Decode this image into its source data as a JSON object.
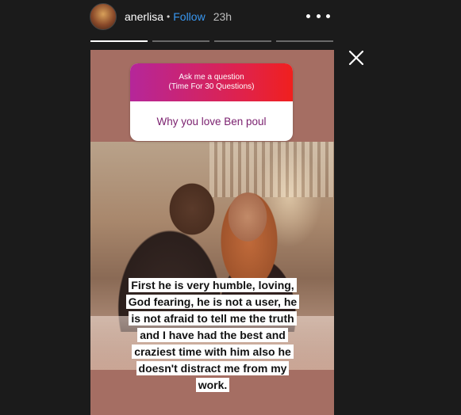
{
  "header": {
    "username": "anerlisa",
    "separator": "•",
    "follow_label": "Follow",
    "time": "23h"
  },
  "progress": [
    1.0,
    0.0,
    0.0,
    0.0
  ],
  "icons": {
    "avatar": "user-avatar",
    "more": "more-dots-icon",
    "close": "close-icon"
  },
  "question_sticker": {
    "title_line1": "Ask me a question",
    "title_line2": "(Time For 30 Questions)",
    "question": "Why you love Ben poul"
  },
  "answer": {
    "line1": "First he is very humble, loving,",
    "line2": "God fearing, he is not a user, he",
    "line3": "is not afraid to tell me the truth",
    "line4": "and I have had the best and",
    "line5": "craziest time with him also he",
    "line6": "doesn't distract me from my",
    "line7": "work."
  },
  "colors": {
    "background": "#1b1b1b",
    "follow": "#3897f0",
    "story_bg": "#a56e63",
    "sticker_gradient_start": "#b5269a",
    "sticker_gradient_end": "#f0201e",
    "question_text": "#7a1f6e"
  }
}
